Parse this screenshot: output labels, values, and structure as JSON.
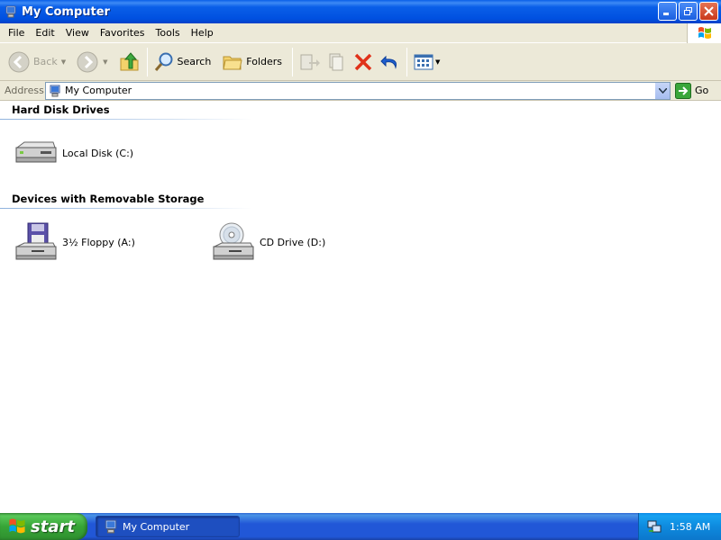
{
  "window": {
    "title": "My Computer"
  },
  "menu": {
    "items": [
      "File",
      "Edit",
      "View",
      "Favorites",
      "Tools",
      "Help"
    ]
  },
  "toolbar": {
    "back_label": "Back",
    "search_label": "Search",
    "folders_label": "Folders"
  },
  "address": {
    "label": "Address",
    "value": "My Computer",
    "go_label": "Go"
  },
  "groups": [
    {
      "title": "Hard Disk Drives",
      "items": [
        {
          "label": "Local Disk (C:)",
          "icon": "hard-disk-icon"
        }
      ]
    },
    {
      "title": "Devices with Removable Storage",
      "items": [
        {
          "label": "3½ Floppy (A:)",
          "icon": "floppy-drive-icon"
        },
        {
          "label": "CD Drive (D:)",
          "icon": "cd-drive-icon"
        }
      ]
    }
  ],
  "taskbar": {
    "start_label": "start",
    "task_label": "My Computer",
    "clock": "1:58 AM"
  },
  "colors": {
    "title_bar": "#0a5fe8",
    "chrome": "#ece9d8",
    "taskbar": "#2157d7",
    "start_button": "#37a537",
    "close_button": "#c8381a"
  }
}
